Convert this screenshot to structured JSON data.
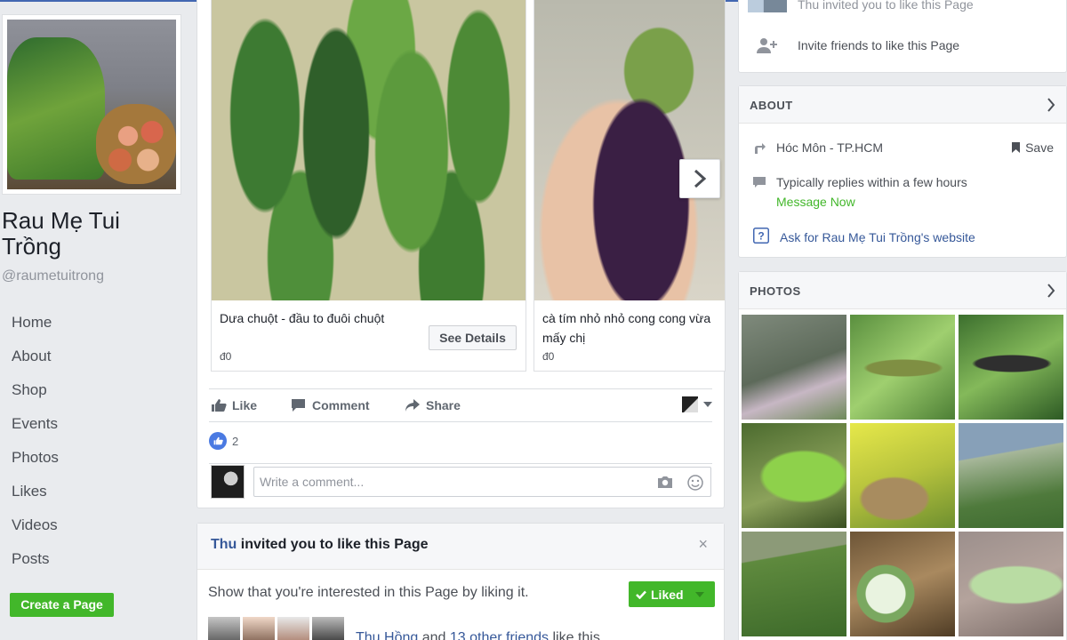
{
  "page": {
    "name": "Rau Mẹ Tui Trồng",
    "handle": "@raumetuitrong"
  },
  "nav": {
    "items": [
      "Home",
      "About",
      "Shop",
      "Events",
      "Photos",
      "Likes",
      "Videos",
      "Posts"
    ],
    "create_page": "Create a Page"
  },
  "products": [
    {
      "title": "Dưa chuột - đầu to đuôi chuột",
      "price": "đ0",
      "button": "See Details"
    },
    {
      "title": "cà tím nhỏ nhỏ cong cong vừa mấy chị",
      "price": "đ0"
    }
  ],
  "post_actions": {
    "like": "Like",
    "comment": "Comment",
    "share": "Share"
  },
  "reactions": {
    "count": "2"
  },
  "comment": {
    "placeholder": "Write a comment..."
  },
  "invite": {
    "who": "Thu",
    "rest": " invited you to like this Page",
    "close": "×",
    "body": "Show that you're interested in this Page by liking it.",
    "liked": "Liked",
    "friend_name": "Thu Hồng",
    "and": " and ",
    "others": "13 other friends",
    "suffix": " like this."
  },
  "right_top": {
    "invited_text": "Thu invited you to like this Page",
    "invite_friends": "Invite friends to like this Page"
  },
  "about": {
    "heading": "ABOUT",
    "location": "Hóc Môn - TP.HCM",
    "save": "Save",
    "reply": "Typically replies within a few hours",
    "message_now": "Message Now",
    "website_ask": "Ask for Rau Mẹ Tui Trồng's website"
  },
  "photos": {
    "heading": "PHOTOS"
  },
  "colors": {
    "accent": "#4267b2",
    "green": "#42b72a",
    "link": "#365899"
  }
}
